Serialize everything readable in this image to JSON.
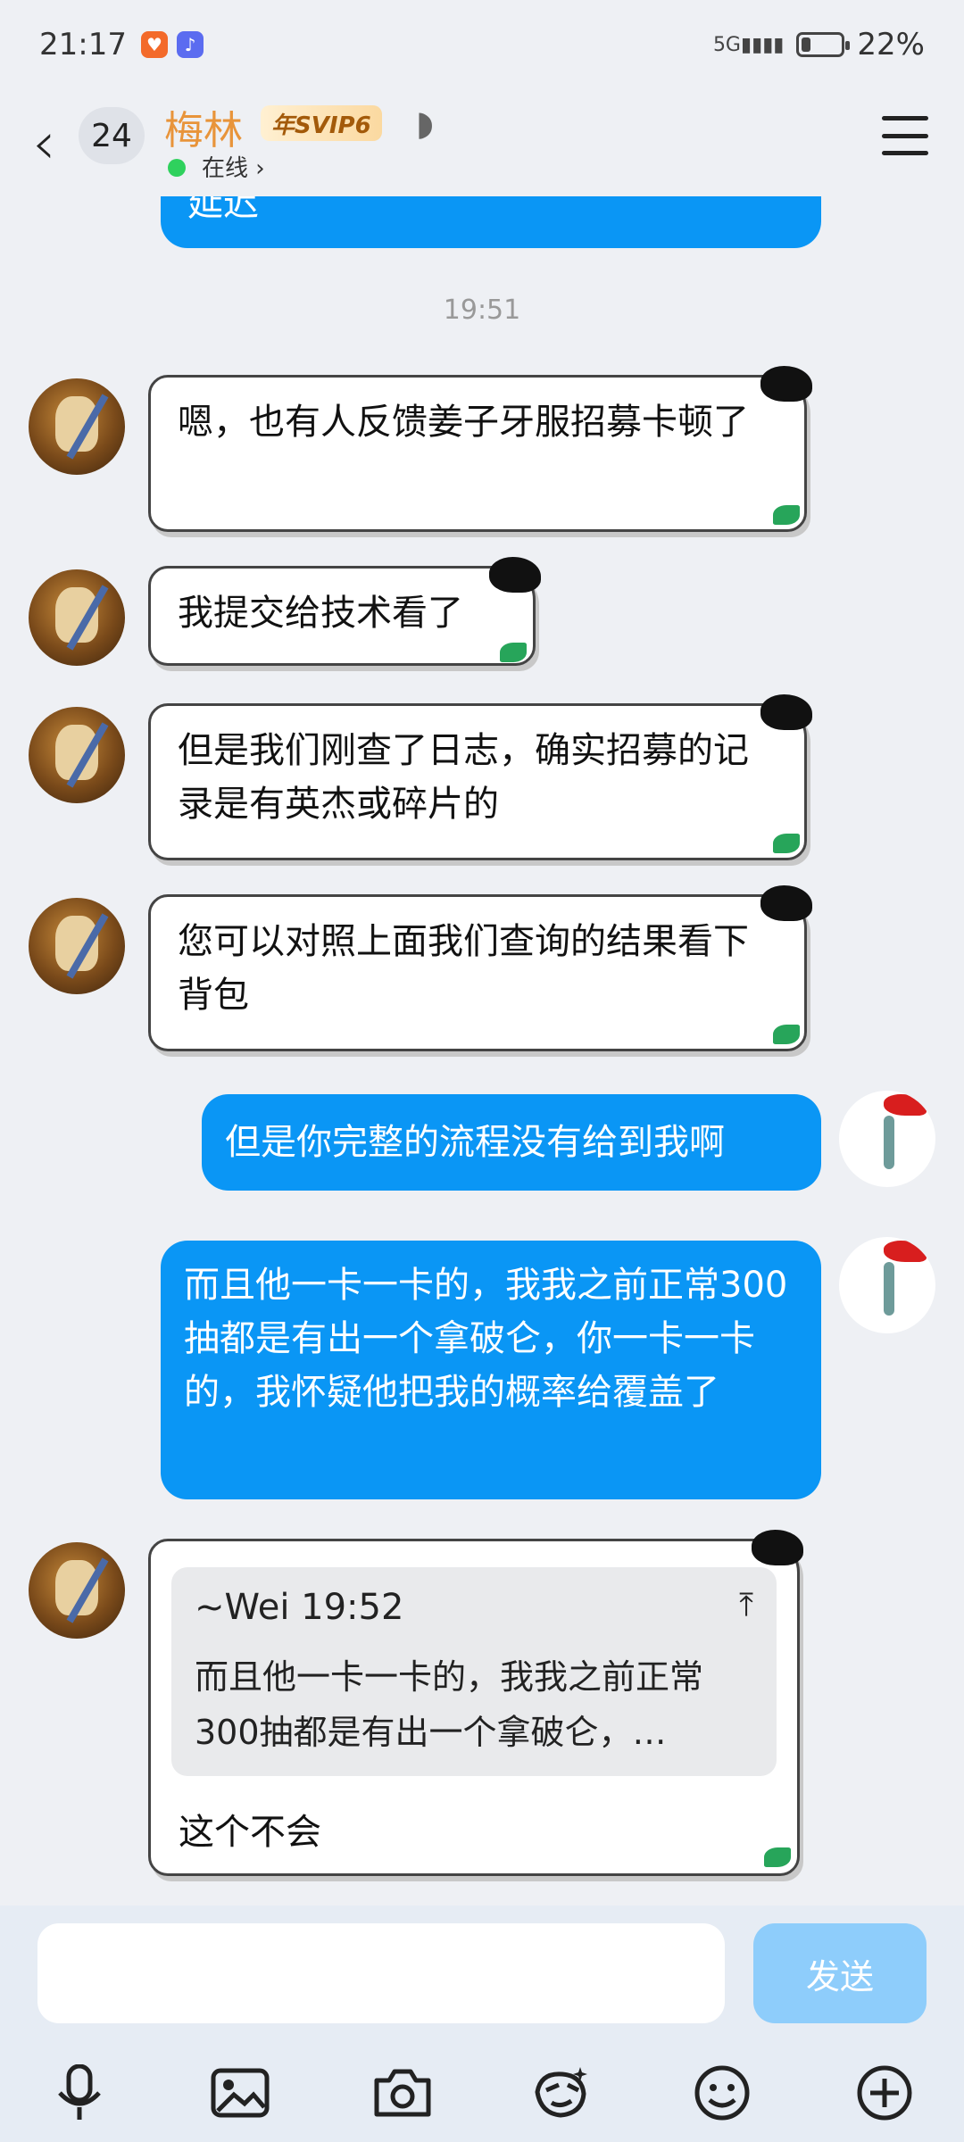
{
  "status_bar": {
    "time": "21:17",
    "network": "5G",
    "battery": "22%",
    "battery_level": 0.22
  },
  "header": {
    "unread_count": "24",
    "contact_name": "梅林",
    "vip_badge": "年SVIP6",
    "status": "在线"
  },
  "messages": {
    "partial_top": "延迟",
    "timestamp": "19:51",
    "m1": "嗯，也有人反馈姜子牙服招募卡顿了",
    "m2": "我提交给技术看了",
    "m3": "但是我们刚查了日志，确实招募的记录是有英杰或碎片的",
    "m4": "您可以对照上面我们查询的结果看下背包",
    "m5": "但是你完整的流程没有给到我啊",
    "m6": "而且他一卡一卡的，我我之前正常300抽都是有出一个拿破仑，你一卡一卡的，我怀疑他把我的概率给覆盖了",
    "quote_header": "~Wei 19:52",
    "quote_body": "而且他一卡一卡的，我我之前正常300抽都是有出一个拿破仑，…",
    "m7": "这个不会"
  },
  "input": {
    "value": "",
    "send_label": "发送"
  },
  "icons": {
    "toolbar": [
      "microphone-icon",
      "image-icon",
      "camera-icon",
      "sticker-icon",
      "emoji-icon",
      "plus-icon"
    ]
  },
  "colors": {
    "accent": "#0a96f5",
    "name": "#e8943a",
    "online": "#2fd15d"
  }
}
